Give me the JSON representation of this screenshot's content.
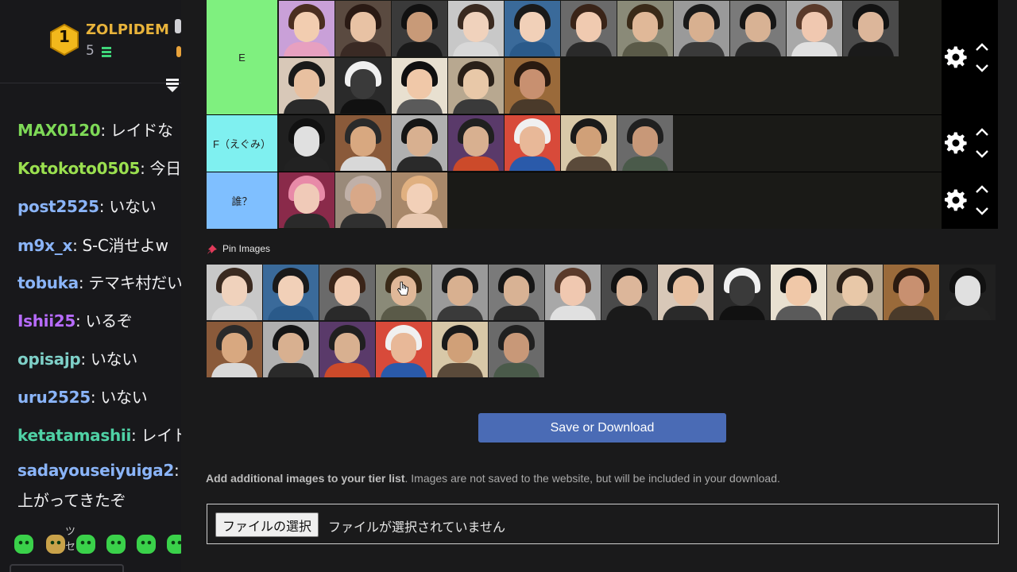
{
  "chat": {
    "top_user": {
      "rank": "1",
      "name": "ZOLPIDEM",
      "count": "5"
    },
    "messages": [
      {
        "user": "MAX0120",
        "text": ": レイドな",
        "color": "#7ed957"
      },
      {
        "user": "Kotokoto0505",
        "text": ": 今日",
        "color": "#9adf4f"
      },
      {
        "user": "post2525",
        "text": ": いない",
        "color": "#8ab4f8"
      },
      {
        "user": "m9x_x",
        "text": ": S-C消せよw",
        "color": "#8ab4f8"
      },
      {
        "user": "tobuka",
        "text": ": テマキ村だい",
        "color": "#8ab4f8"
      },
      {
        "user": "Ishii25",
        "text": ": いるぞ",
        "color": "#b76bff"
      },
      {
        "user": "opisajp",
        "text": ": いない",
        "color": "#7ed0c8"
      },
      {
        "user": "uru2525",
        "text": ": いない",
        "color": "#8ab4f8"
      },
      {
        "user": "ketatamashii",
        "text": ": レイト",
        "color": "#4fd1a5"
      },
      {
        "user": "sadayouseiyuiga2",
        "text": ":",
        "color": "#8ab4f8"
      },
      {
        "user": "",
        "text": "上がってきたぞ",
        "color": "#efeff1"
      }
    ],
    "emote_tooltip": "ツ\nセ"
  },
  "tiers": [
    {
      "label": "E",
      "color": "#7ff07f"
    },
    {
      "label": "F（えぐみ）",
      "color": "#7ff0f0"
    },
    {
      "label": "誰？",
      "color": "#7fbfff"
    }
  ],
  "pin": {
    "title": "Pin Images"
  },
  "save_button": "Save or Download",
  "add_images": {
    "bold": "Add additional images to your tier list",
    "rest": ". Images are not saved to the website, but will be included in your download."
  },
  "file_input": {
    "button": "ファイルの選択",
    "status": "ファイルが選択されていません"
  },
  "colors": {
    "accent_button": "#4a6bb5",
    "tier_ctrl_bg": "#000000",
    "page_bg": "#1a1a1b"
  }
}
